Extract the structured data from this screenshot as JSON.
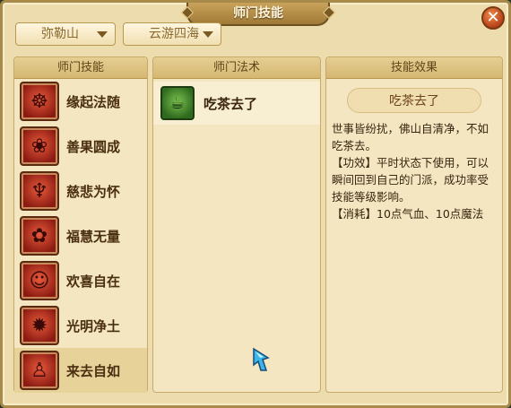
{
  "window": {
    "title": "师门技能",
    "close_icon": "close-icon"
  },
  "filters": {
    "mountain": "弥勒山",
    "travel": "云游四海"
  },
  "skills_panel": {
    "header": "师门技能",
    "items": [
      {
        "label": "缘起法随",
        "icon": "mudra-icon"
      },
      {
        "label": "善果圆成",
        "icon": "fruit-icon"
      },
      {
        "label": "慈悲为怀",
        "icon": "praying-hands-icon"
      },
      {
        "label": "福慧无量",
        "icon": "lotus-icon"
      },
      {
        "label": "欢喜自在",
        "icon": "buddha-icon"
      },
      {
        "label": "光明净土",
        "icon": "flame-icon"
      },
      {
        "label": "来去自如",
        "icon": "meditating-monk-icon"
      }
    ],
    "selected_index": 6
  },
  "spells_panel": {
    "header": "师门法术",
    "items": [
      {
        "label": "吃茶去了",
        "icon": "teapot-icon"
      }
    ]
  },
  "effect_panel": {
    "header": "技能效果",
    "name": "吃茶去了",
    "description": "世事皆纷扰，佛山自清净，不如吃茶去。",
    "function": "【功效】平时状态下使用，可以瞬间回到自己的门派，成功率受技能等级影响。",
    "cost": "【消耗】10点气血、10点魔法"
  }
}
